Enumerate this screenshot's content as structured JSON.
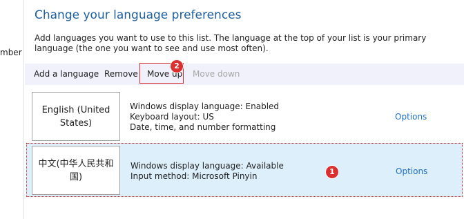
{
  "left_pane": {
    "fragment": "mber"
  },
  "header": {
    "title": "Change your language preferences",
    "description": "Add languages you want to use to this list. The language at the top of your list is your primary language (the one you want to see and use most often)."
  },
  "toolbar": {
    "add_label": "Add a language",
    "remove_label": "Remove",
    "move_up_label": "Move up",
    "move_down_label": "Move down"
  },
  "languages": [
    {
      "name": "English (United States)",
      "details": [
        "Windows display language: Enabled",
        "Keyboard layout: US",
        "Date, time, and number formatting"
      ],
      "options_label": "Options"
    },
    {
      "name": "中文(中华人民共和国)",
      "details": [
        "Windows display language: Available",
        "Input method: Microsoft Pinyin"
      ],
      "options_label": "Options"
    }
  ],
  "markers": {
    "row": "1",
    "move_up": "2"
  },
  "colors": {
    "accent": "#1d5e9f",
    "link": "#1d6fc4",
    "selection": "#deeffc",
    "highlight": "#d22b2b"
  }
}
